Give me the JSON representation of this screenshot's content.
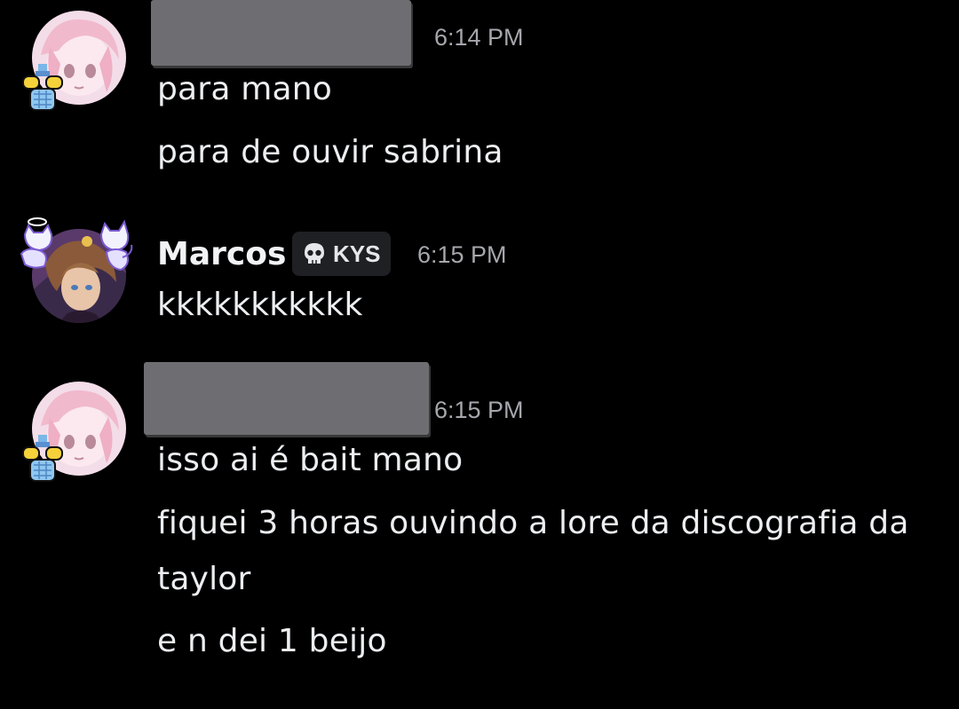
{
  "messages": [
    {
      "author": "",
      "author_redacted": true,
      "avatar_icon": "anime-pink-hair-avatar",
      "decoration_icon": "perfume-bottle-icon",
      "time": "6:14 PM",
      "lines": [
        "para mano",
        "para de ouvir sabrina"
      ]
    },
    {
      "author": "Marcos",
      "author_redacted": false,
      "avatar_icon": "anime-brown-hair-avatar",
      "decoration_icon": "white-cats-decoration-icon",
      "tag": {
        "icon": "skull-icon",
        "label": "KYS"
      },
      "time": "6:15 PM",
      "lines": [
        "kkkkkkkkkkk"
      ]
    },
    {
      "author": "",
      "author_redacted": true,
      "avatar_icon": "anime-pink-hair-avatar",
      "decoration_icon": "perfume-bottle-icon",
      "time": "6:15 PM",
      "lines": [
        "isso ai é bait mano",
        "fiquei 3 horas ouvindo a lore da discografia da",
        "taylor",
        "e n dei 1 beijo"
      ]
    }
  ],
  "colors": {
    "background": "#000000",
    "text": "#eceef1",
    "timestamp": "#a6a7ad",
    "redaction": "#6e6e72",
    "tag_bg": "#1f2024"
  }
}
